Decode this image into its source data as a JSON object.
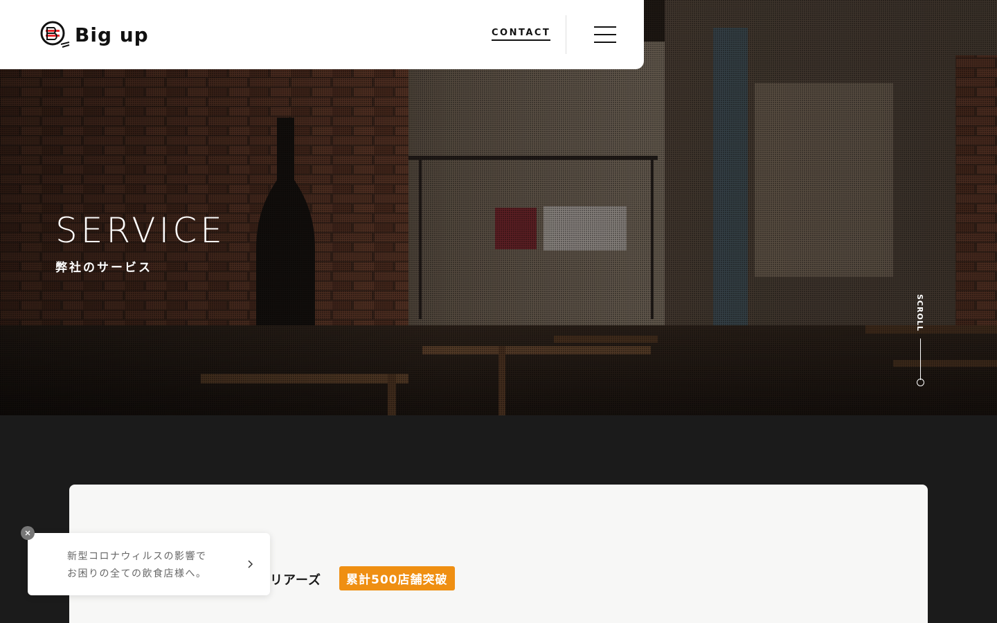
{
  "header": {
    "logo_text": "Big up",
    "contact_label": "CONTACT",
    "menu_icon": "hamburger-menu-icon"
  },
  "hero": {
    "title": "SERVICE",
    "subtitle": "弊社のサービス",
    "scroll_label": "SCROLL"
  },
  "content": {
    "service_label": "リアーズ",
    "badge": "累計500店舗突破",
    "badge_color": "#ef8f12"
  },
  "notice": {
    "line1": "新型コロナウィルスの影響で",
    "line2": "お困りの全ての飲食店様へ。",
    "arrow_icon": "chevron-right-icon",
    "close_icon": "close-icon"
  },
  "colors": {
    "background_dark": "#1b1b1b",
    "header_bg": "#ffffff",
    "card_bg": "#f7f7f6",
    "accent": "#ef8f12"
  }
}
